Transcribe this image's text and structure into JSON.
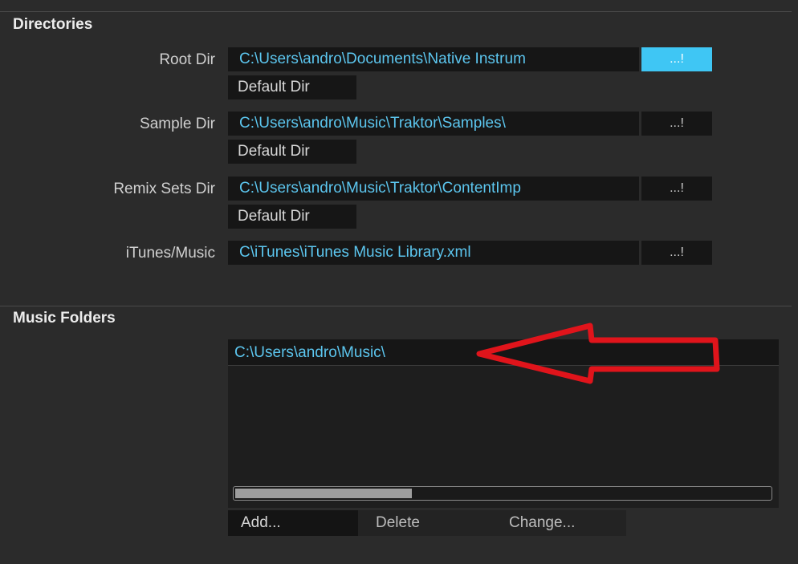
{
  "directories": {
    "title": "Directories",
    "rows": [
      {
        "label": "Root Dir",
        "path": "C:\\Users\\andro\\Documents\\Native Instrum",
        "browse": "...!",
        "default": "Default Dir"
      },
      {
        "label": "Sample Dir",
        "path": "C:\\Users\\andro\\Music\\Traktor\\Samples\\",
        "browse": "...!",
        "default": "Default Dir"
      },
      {
        "label": "Remix Sets Dir",
        "path": "C:\\Users\\andro\\Music\\Traktor\\ContentImp",
        "browse": "...!",
        "default": "Default Dir"
      },
      {
        "label": "iTunes/Music",
        "path": "C\\iTunes\\iTunes Music Library.xml",
        "browse": "...!"
      }
    ]
  },
  "music_folders": {
    "title": "Music Folders",
    "items": [
      "C:\\Users\\andro\\Music\\"
    ],
    "scroll_position": 0.33,
    "buttons": {
      "add": "Add...",
      "delete": "Delete",
      "change": "Change..."
    }
  },
  "colors": {
    "accent": "#3fc6f4",
    "path_text": "#5cc6ef",
    "annotation_arrow": "#e0141b"
  }
}
